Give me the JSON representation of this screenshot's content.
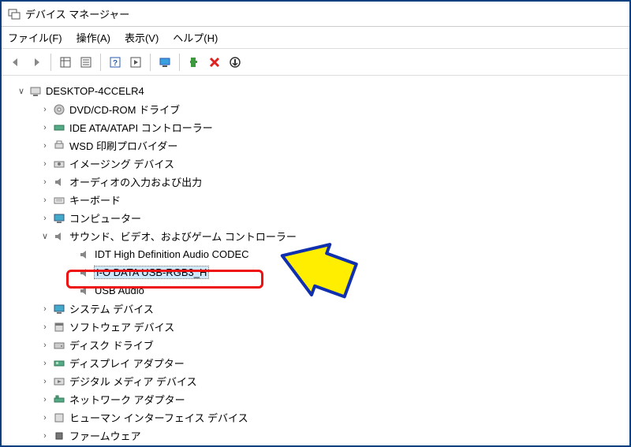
{
  "window": {
    "title": "デバイス マネージャー"
  },
  "menu": {
    "file": "ファイル(F)",
    "action": "操作(A)",
    "view": "表示(V)",
    "help": "ヘルプ(H)"
  },
  "tree": {
    "root": "DESKTOP-4CCELR4",
    "dvd": "DVD/CD-ROM ドライブ",
    "ide": "IDE ATA/ATAPI コントローラー",
    "wsd": "WSD 印刷プロバイダー",
    "imaging": "イメージング デバイス",
    "audio_io": "オーディオの入力および出力",
    "keyboard": "キーボード",
    "computer": "コンピューター",
    "sound": "サウンド、ビデオ、およびゲーム コントローラー",
    "sound_child1": "IDT High Definition Audio CODEC",
    "sound_child2": "I-O DATA USB-RGB3_H",
    "sound_child3": "USB Audio",
    "system": "システム デバイス",
    "software": "ソフトウェア デバイス",
    "disk": "ディスク ドライブ",
    "display": "ディスプレイ アダプター",
    "digital_media": "デジタル メディア デバイス",
    "network": "ネットワーク アダプター",
    "hid": "ヒューマン インターフェイス デバイス",
    "firmware": "ファームウェア"
  }
}
